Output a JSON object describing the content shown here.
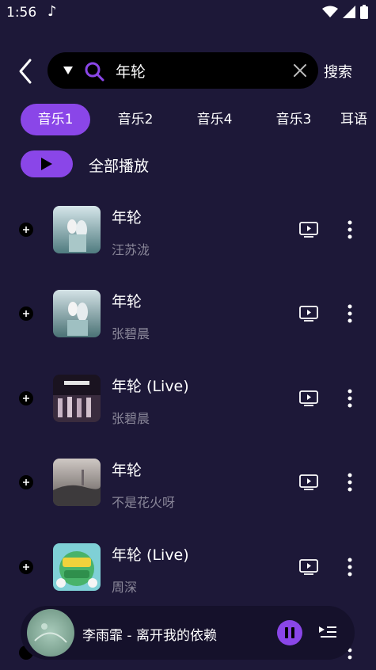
{
  "status_bar": {
    "time": "1:56",
    "music_note": "♪"
  },
  "header": {
    "search_query": "年轮",
    "search_button": "搜索"
  },
  "tabs": [
    {
      "label": "音乐1",
      "active": true
    },
    {
      "label": "音乐2",
      "active": false
    },
    {
      "label": "音乐4",
      "active": false
    },
    {
      "label": "音乐3",
      "active": false
    },
    {
      "label": "耳语",
      "active": false
    }
  ],
  "play_all": {
    "label": "全部播放"
  },
  "songs": [
    {
      "title": "年轮",
      "artist": "汪苏泷"
    },
    {
      "title": "年轮",
      "artist": "张碧晨"
    },
    {
      "title": "年轮 (Live)",
      "artist": "张碧晨"
    },
    {
      "title": "年轮",
      "artist": "不是花火呀"
    },
    {
      "title": "年轮 (Live)",
      "artist": "周深"
    }
  ],
  "mini_player": {
    "now_playing": "李雨霏 - 离开我的依赖"
  },
  "colors": {
    "background": "#1d1838",
    "accent": "#8a46e8",
    "secondary_text": "#8a8799"
  }
}
